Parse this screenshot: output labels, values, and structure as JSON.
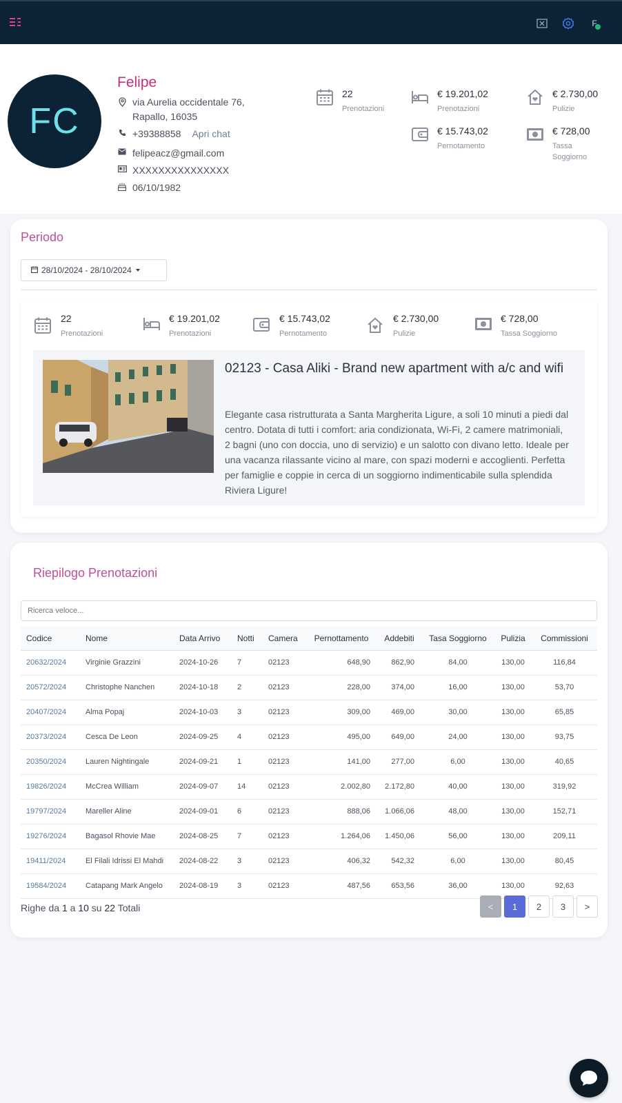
{
  "topbar": {
    "user_initial": "F"
  },
  "profile": {
    "initials": "FC",
    "name": "Felipe",
    "address_line1": "via Aurelia occidentale 76,",
    "address_line2": "Rapallo, 16035",
    "phone": "+39388858",
    "chat_label": "Apri chat",
    "email": "felipeacz@gmail.com",
    "document": "XXXXXXXXXXXXXXX",
    "birthdate": "06/10/1982",
    "stats": [
      {
        "value": "22",
        "label": "Prenotazioni",
        "icon": "calendar-icon"
      },
      {
        "value": "€ 19.201,02",
        "label": "Prenotazioni",
        "icon": "bed-icon"
      },
      {
        "value": "€ 2.730,00",
        "label": "Pulizie",
        "icon": "house-icon"
      },
      {
        "value": "€ 15.743,02",
        "label": "Pernotamento",
        "icon": "wallet-icon"
      },
      {
        "value": "€ 728,00",
        "label": "Tassa Soggiorno",
        "icon": "cash-icon"
      }
    ]
  },
  "periodo": {
    "title": "Periodo",
    "date_range": "28/10/2024 - 28/10/2024",
    "stats": [
      {
        "value": "22",
        "label": "Prenotazioni",
        "icon": "calendar-icon"
      },
      {
        "value": "€ 19.201,02",
        "label": "Prenotazioni",
        "icon": "bed-icon"
      },
      {
        "value": "€ 15.743,02",
        "label": "Pernotamento",
        "icon": "wallet-icon"
      },
      {
        "value": "€ 2.730,00",
        "label": "Pulizie",
        "icon": "house-icon"
      },
      {
        "value": "€ 728,00",
        "label": "Tassa Soggiorno",
        "icon": "cash-icon"
      }
    ],
    "listing": {
      "title": "02123 - Casa Aliki - Brand new apartment with a/c and wifi",
      "description": "Elegante casa ristrutturata a Santa Margherita Ligure, a soli 10 minuti a piedi dal centro. Dotata di tutti i comfort: aria condizionata, Wi-Fi, 2 camere matrimoniali, 2 bagni (uno con doccia, uno di servizio) e un salotto con divano letto. Ideale per una vacanza rilassante vicino al mare, con spazi moderni e accoglienti. Perfetta per famiglie e coppie in cerca di un soggiorno indimenticabile sulla splendida Riviera Ligure!"
    }
  },
  "riepilogo": {
    "title": "Riepilogo Prenotazioni",
    "search_placeholder": "Ricerca veloce...",
    "columns": [
      "Codice",
      "Nome",
      "Data Arrivo",
      "Notti",
      "Camera",
      "Pernottamento",
      "Addebiti",
      "Tasa Soggiorno",
      "Pulizia",
      "Commissioni"
    ],
    "rows": [
      [
        "20632/2024",
        "Virginie Grazzini",
        "2024-10-26",
        "7",
        "02123",
        "648,90",
        "862,90",
        "84,00",
        "130,00",
        "116,84"
      ],
      [
        "20572/2024",
        "Christophe Nanchen",
        "2024-10-18",
        "2",
        "02123",
        "228,00",
        "374,00",
        "16,00",
        "130,00",
        "53,70"
      ],
      [
        "20407/2024",
        "Alma Popaj",
        "2024-10-03",
        "3",
        "02123",
        "309,00",
        "469,00",
        "30,00",
        "130,00",
        "65,85"
      ],
      [
        "20373/2024",
        "Cesca De Leon",
        "2024-09-25",
        "4",
        "02123",
        "495,00",
        "649,00",
        "24,00",
        "130,00",
        "93,75"
      ],
      [
        "20350/2024",
        "Lauren Nightingale",
        "2024-09-21",
        "1",
        "02123",
        "141,00",
        "277,00",
        "6,00",
        "130,00",
        "40,65"
      ],
      [
        "19826/2024",
        "McCrea William",
        "2024-09-07",
        "14",
        "02123",
        "2.002,80",
        "2.172,80",
        "40,00",
        "130,00",
        "319,92"
      ],
      [
        "19797/2024",
        "Mareller Aline",
        "2024-09-01",
        "6",
        "02123",
        "888,06",
        "1.066,06",
        "48,00",
        "130,00",
        "152,71"
      ],
      [
        "19276/2024",
        "Bagasol Rhovie Mae",
        "2024-08-25",
        "7",
        "02123",
        "1.264,06",
        "1.450,06",
        "56,00",
        "130,00",
        "209,11"
      ],
      [
        "19411/2024",
        "El Filali Idrissi El Mahdi",
        "2024-08-22",
        "3",
        "02123",
        "406,32",
        "542,32",
        "6,00",
        "130,00",
        "80,45"
      ],
      [
        "19584/2024",
        "Catapang Mark Angelo",
        "2024-08-19",
        "3",
        "02123",
        "487,56",
        "653,56",
        "36,00",
        "130,00",
        "92,63"
      ]
    ],
    "footer": {
      "prefix": "Righe da",
      "from": "1",
      "a": "a",
      "to": "10",
      "su": "su",
      "total": "22",
      "suffix": "Totali"
    },
    "pagination": [
      "<",
      "1",
      "2",
      "3",
      ">"
    ]
  },
  "colors": {
    "accent": "#c0307f",
    "topbar": "#0c2336",
    "primary": "#5b6bd8",
    "online": "#1fb87a"
  }
}
